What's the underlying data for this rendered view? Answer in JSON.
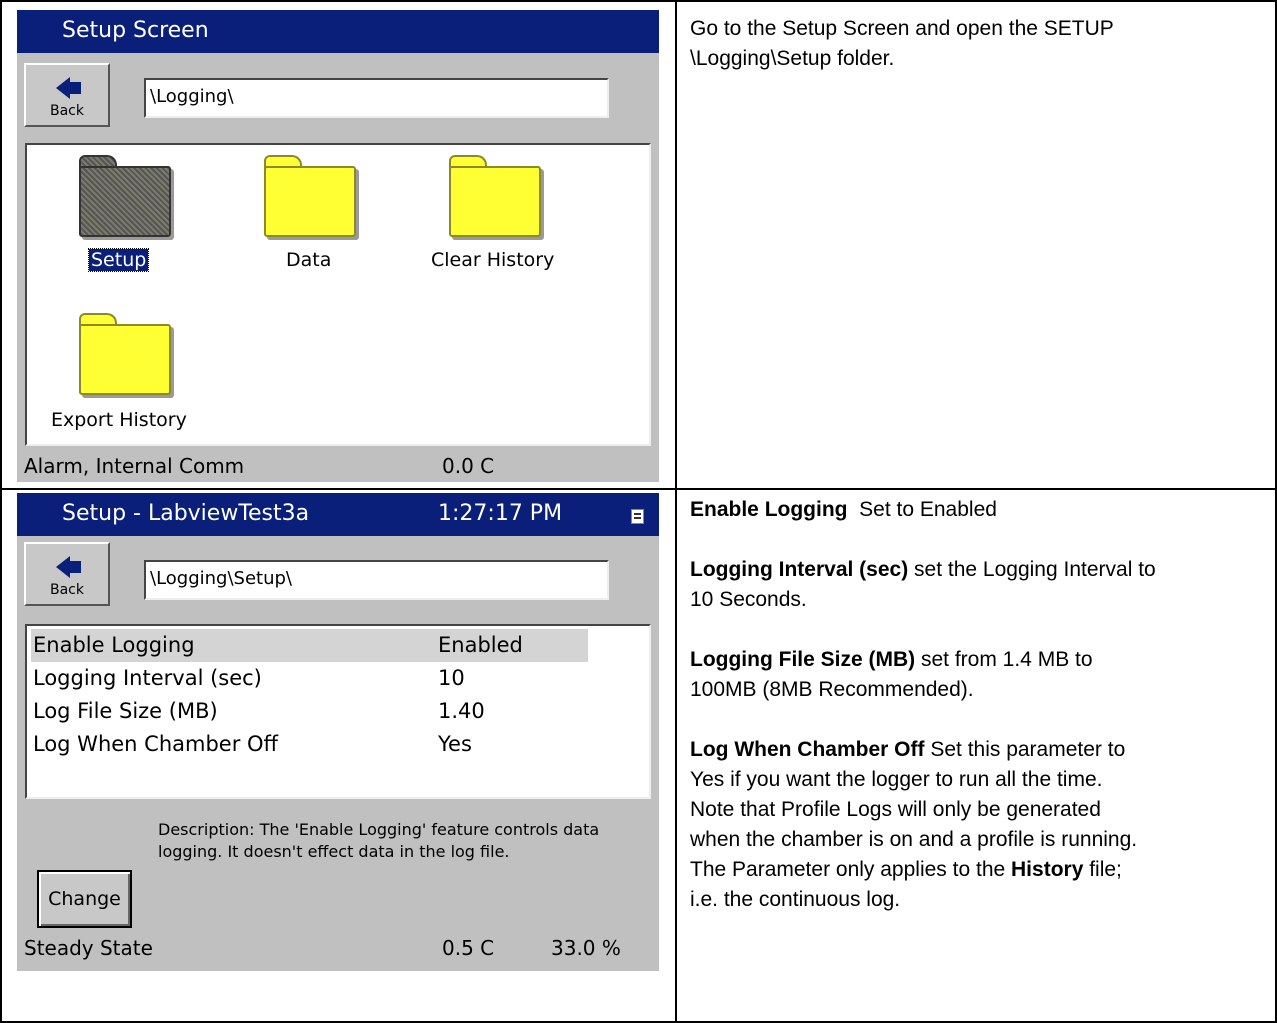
{
  "screen1": {
    "title": "Setup Screen",
    "back_label": "Back",
    "path": "\\Logging\\",
    "folders": [
      {
        "label": "Setup"
      },
      {
        "label": "Data"
      },
      {
        "label": "Clear History"
      },
      {
        "label": "Export History"
      }
    ],
    "status_left": "Alarm, Internal Comm",
    "status_temp": "0.0 C"
  },
  "screen2": {
    "title": "Setup - LabviewTest3a",
    "time": "1:27:17 PM",
    "back_label": "Back",
    "path": "\\Logging\\Setup\\",
    "rows": [
      {
        "key": "Enable Logging",
        "value": "Enabled"
      },
      {
        "key": "Logging Interval (sec)",
        "value": "10"
      },
      {
        "key": "Log File Size (MB)",
        "value": "1.40"
      },
      {
        "key": "Log When Chamber Off",
        "value": "Yes"
      }
    ],
    "description": "Description:  The 'Enable Logging' feature controls data logging. It doesn't effect data in the log file.",
    "change_label": "Change",
    "status_left": "Steady State",
    "status_temp": "0.5 C",
    "status_humidity": "33.0 %"
  },
  "text1": {
    "line1": "Go to the Setup Screen and open the SETUP",
    "line2": "\\Logging\\Setup folder."
  },
  "text2": {
    "p1_bold": "Enable Logging",
    "p1_rest": "  Set to Enabled",
    "p2_bold": "Logging Interval (sec)",
    "p2_rest": " set the Logging Interval to",
    "p2_line2": "10 Seconds.",
    "p3_bold": "Logging File Size (MB)",
    "p3_rest": " set from 1.4 MB to",
    "p3_line2": "100MB (8MB Recommended).",
    "p4_bold": "Log When Chamber Off",
    "p4_rest": " Set this parameter to",
    "p4_line2": "Yes if you want the logger to run all the time.",
    "p4_line3": "Note that Profile Logs will only be generated",
    "p4_line4": "when the chamber is on and a profile is running.",
    "p4_line5_pre": "The Parameter only applies to the ",
    "p4_line5_bold": "History",
    "p4_line5_post": " file;",
    "p4_line6": "i.e. the continuous log."
  }
}
